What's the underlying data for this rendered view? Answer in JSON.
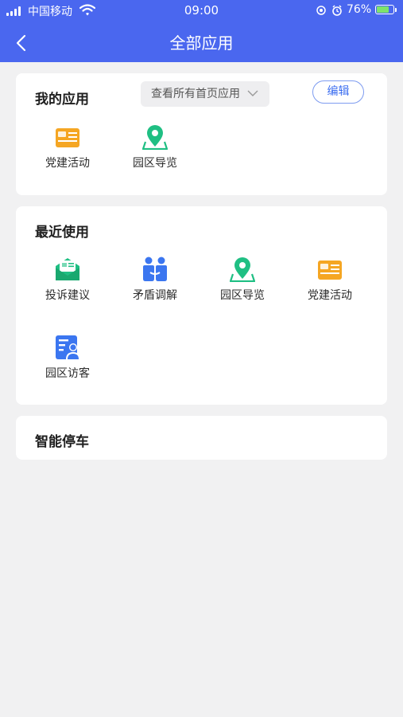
{
  "status_bar": {
    "carrier": "中国移动",
    "time": "09:00",
    "battery": "76%",
    "battery_level": 0.76
  },
  "header": {
    "title": "全部应用"
  },
  "my_apps": {
    "title": "我的应用",
    "filter": "查看所有首页应用",
    "edit_label": "编辑",
    "apps": [
      {
        "label": "党建活动",
        "icon": "party-activity-icon"
      },
      {
        "label": "园区导览",
        "icon": "map-pin-icon"
      }
    ]
  },
  "recent": {
    "title": "最近使用",
    "apps": [
      {
        "label": "投诉建议",
        "icon": "complaint-envelope-icon"
      },
      {
        "label": "矛盾调解",
        "icon": "mediation-people-icon"
      },
      {
        "label": "园区导览",
        "icon": "map-pin-icon"
      },
      {
        "label": "党建活动",
        "icon": "party-activity-icon"
      },
      {
        "label": "园区访客",
        "icon": "visitor-icon"
      }
    ]
  },
  "parking": {
    "title": "智能停车"
  },
  "colors": {
    "header": "#4a67ef",
    "orange": "#f5a623",
    "green": "#1fbf83",
    "blue": "#3b76f0"
  }
}
